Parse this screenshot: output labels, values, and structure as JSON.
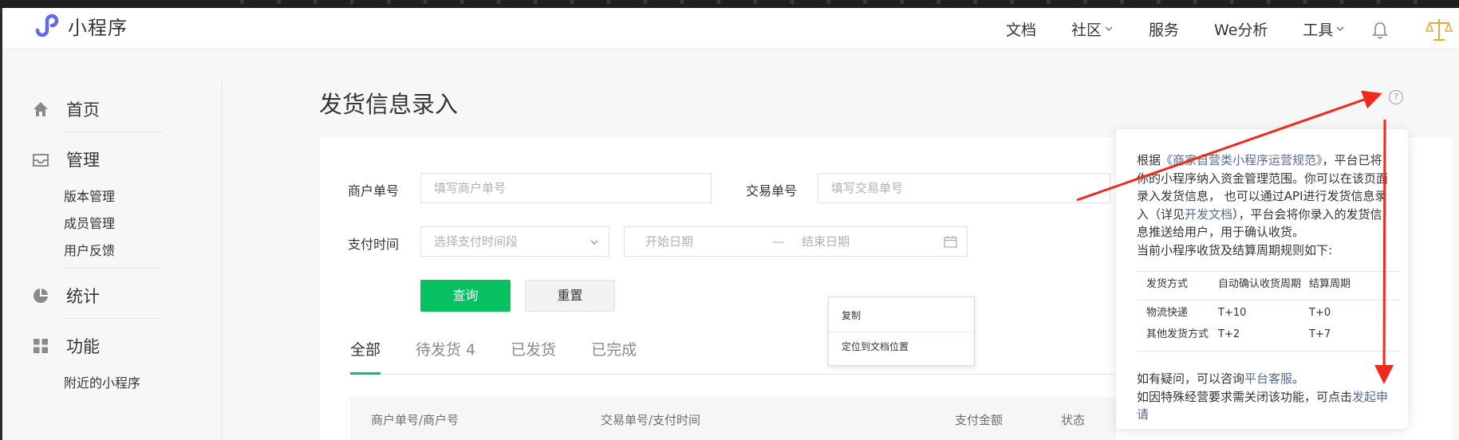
{
  "header": {
    "app_name": "小程序",
    "nav": [
      {
        "label": "文档"
      },
      {
        "label": "社区"
      },
      {
        "label": "服务"
      },
      {
        "label": "We分析"
      },
      {
        "label": "工具"
      }
    ]
  },
  "sidebar": {
    "sections": [
      {
        "label": "首页",
        "icon": "home-icon"
      },
      {
        "label": "管理",
        "icon": "inbox-icon"
      },
      {
        "label": "统计",
        "icon": "pie-chart-icon"
      },
      {
        "label": "功能",
        "icon": "grid-icon"
      }
    ],
    "manage_items": [
      "版本管理",
      "成员管理",
      "用户反馈"
    ],
    "feature_items": [
      "附近的小程序"
    ]
  },
  "page": {
    "title": "发货信息录入"
  },
  "filters": {
    "merchant_order_label": "商户单号",
    "merchant_order_placeholder": "填写商户单号",
    "transaction_label": "交易单号",
    "transaction_placeholder": "填写交易单号",
    "pay_time_label": "支付时间",
    "pay_time_placeholder": "选择支付时间段",
    "start_date_placeholder": "开始日期",
    "range_sep": "—",
    "end_date_placeholder": "结束日期",
    "query_button": "查询",
    "reset_button": "重置"
  },
  "tabs": [
    {
      "label": "全部",
      "active": true
    },
    {
      "label": "待发货 4",
      "active": false
    },
    {
      "label": "已发货",
      "active": false
    },
    {
      "label": "已完成",
      "active": false
    }
  ],
  "table": {
    "headers": [
      "商户单号/商户号",
      "交易单号/支付时间",
      "支付金额",
      "状态"
    ]
  },
  "context_menu": {
    "items": [
      "复制",
      "定位到文档位置"
    ]
  },
  "popover": {
    "p1_a": "根据",
    "p1_link": "《商家自营类小程序运营规范》",
    "p1_b": "，平台已将你的小程序纳入资金管理范围。你可以在该页面录入发货信息， 也可以通过API进行发货信息录入（详见",
    "p1_link2": "开发文档",
    "p1_c": "），平台会将你录入的发货信息推送给用户，用于确认收货。",
    "p2": "当前小程序收货及结算周期规则如下:",
    "table_headers": [
      "发货方式",
      "自动确认收货周期",
      "结算周期"
    ],
    "table_rows": [
      [
        "物流快递",
        "T+10",
        "T+0"
      ],
      [
        "其他发货方式",
        "T+2",
        "T+7"
      ]
    ],
    "foot1_a": "如有疑问，可以咨询",
    "foot1_link": "平台客服",
    "foot1_b": "。",
    "foot2_a": "如因特殊经营要求需关闭该功能，可点击",
    "foot2_link": "发起申请"
  },
  "colors": {
    "primary": "#07c160",
    "link": "#576b95",
    "annotation_arrow": "#ee2a1e"
  }
}
